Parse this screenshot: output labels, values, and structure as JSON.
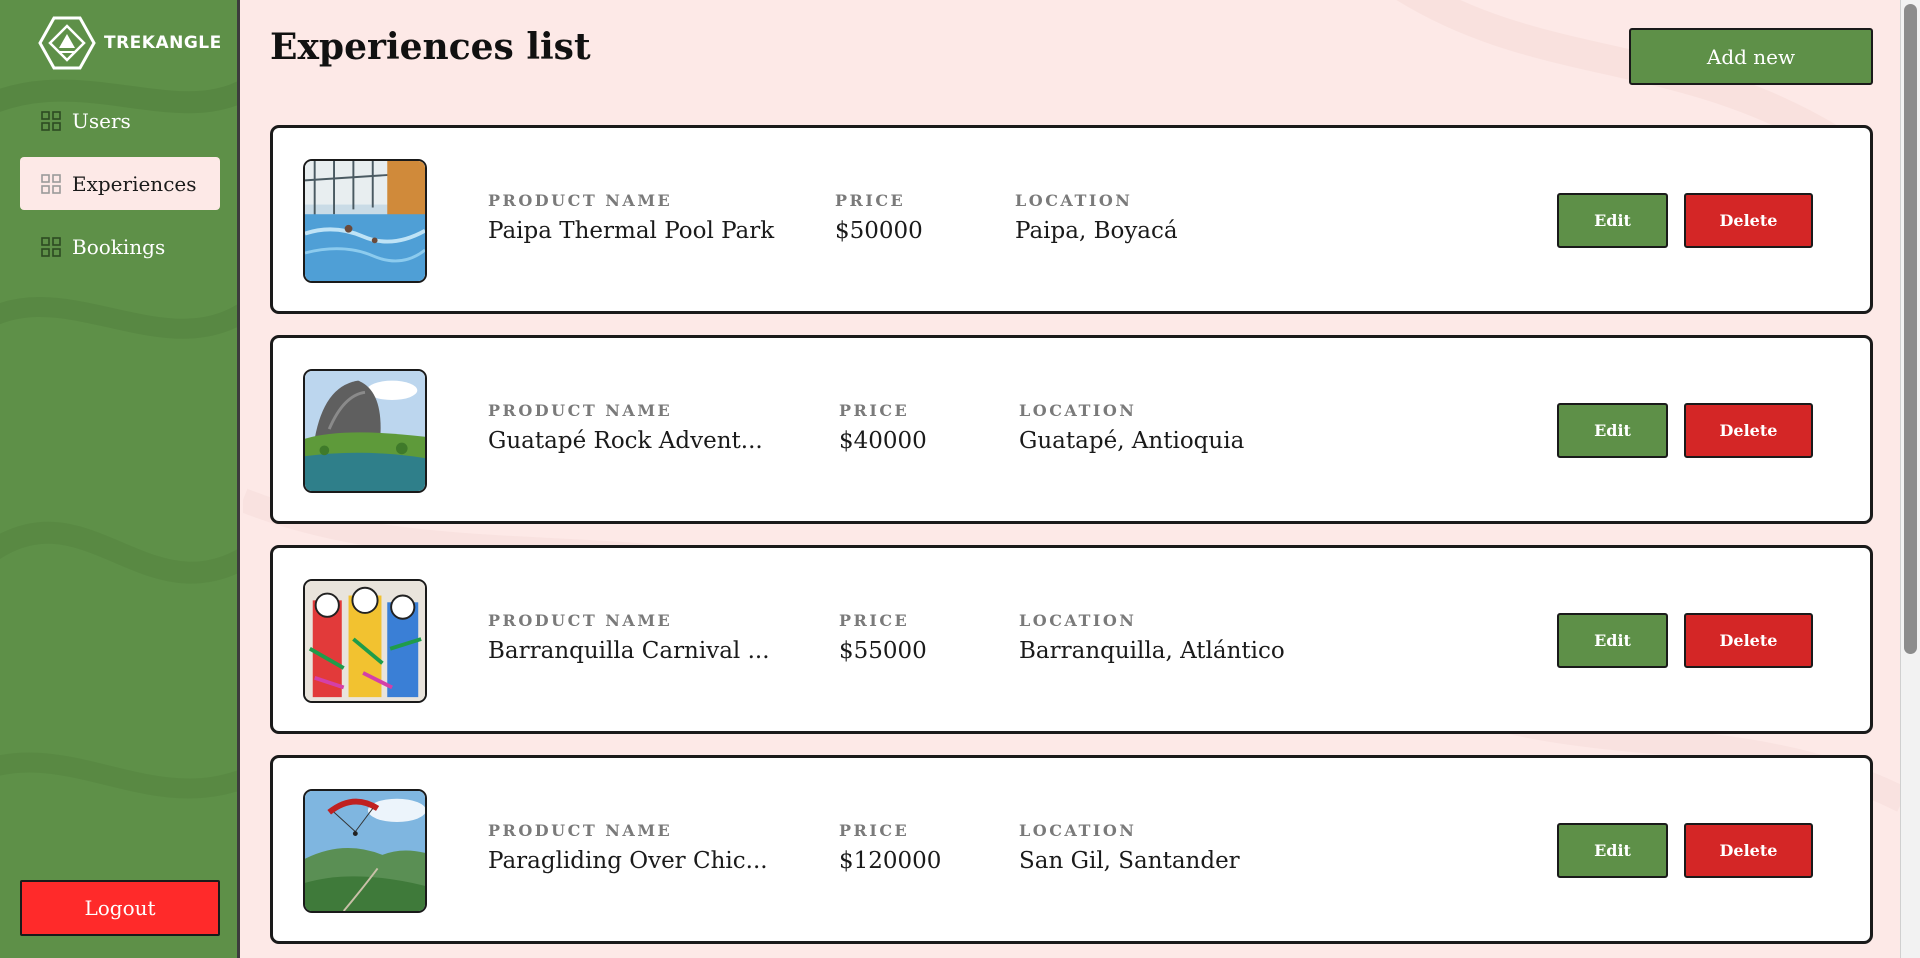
{
  "brand": {
    "name": "TREKANGLE"
  },
  "sidebar": {
    "items": [
      {
        "label": "Users",
        "active": false
      },
      {
        "label": "Experiences",
        "active": true
      },
      {
        "label": "Bookings",
        "active": false
      }
    ],
    "logout_label": "Logout"
  },
  "main": {
    "title": "Experiences list",
    "add_new_label": "Add new",
    "labels": {
      "product_name": "PRODUCT NAME",
      "price": "PRICE",
      "location": "LOCATION",
      "edit": "Edit",
      "delete": "Delete"
    },
    "experiences": [
      {
        "name": "Paipa Thermal Pool Park",
        "price": "$50000",
        "location": "Paipa, Boyacá",
        "image": "thermal-pool-photo"
      },
      {
        "name": "Guatapé Rock Advent...",
        "price": "$40000",
        "location": "Guatapé, Antioquia",
        "image": "guatape-rock-photo"
      },
      {
        "name": "Barranquilla Carnival ...",
        "price": "$55000",
        "location": "Barranquilla, Atlántico",
        "image": "carnival-photo"
      },
      {
        "name": "Paragliding Over Chic...",
        "price": "$120000",
        "location": "San Gil, Santander",
        "image": "paragliding-photo"
      }
    ]
  },
  "colors": {
    "brand_green": "#5e9048",
    "delete_red": "#d42626",
    "logout_red": "#ff2a2a",
    "page_background": "#fde9e7"
  }
}
